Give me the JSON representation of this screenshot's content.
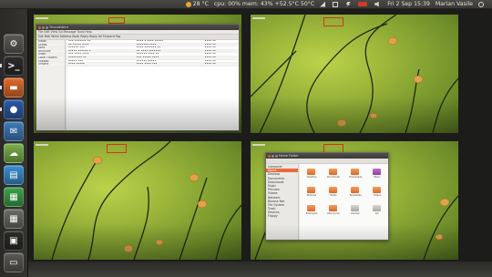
{
  "panel": {
    "weather": "28 °C",
    "sysmon": "cpu: 00% mem: 43% +52.5°C 50°C",
    "datetime": "Fri 2 Sep 15:39",
    "user": "Marian Vasile"
  },
  "launcher": {
    "items": [
      {
        "name": "dash-home",
        "glyph": "⚙",
        "color": "#5b5a55"
      },
      {
        "name": "terminal",
        "glyph": ">_",
        "color": "#2c2c2c"
      },
      {
        "name": "files",
        "glyph": "▬",
        "color": "#e06a2c"
      },
      {
        "name": "firefox",
        "glyph": "●",
        "color": "#2d5aa5"
      },
      {
        "name": "thunderbird",
        "glyph": "✉",
        "color": "#3f7bb8"
      },
      {
        "name": "pidgin",
        "glyph": "☁",
        "color": "#7bb04a"
      },
      {
        "name": "writer",
        "glyph": "▤",
        "color": "#3b8fd0"
      },
      {
        "name": "calc",
        "glyph": "▦",
        "color": "#3ea14a"
      },
      {
        "name": "calculator",
        "glyph": "▦",
        "color": "#6b6b66"
      },
      {
        "name": "ubuntu-one",
        "glyph": "▣",
        "color": "#2b2b28"
      },
      {
        "name": "workspace-switcher",
        "glyph": "▭",
        "color": "#5a5954"
      }
    ]
  },
  "workspaces": {
    "ws1": {
      "window_title": "Thunderbird",
      "menubar": "File  Edit  View  Go  Message  Tools  Help",
      "toolbar": "Get Mail  Write  Address Book  Reply  Reply All  Forward  Tag",
      "folders": [
        "Inbox",
        "Drafts",
        "Sent",
        "Archives",
        "Trash",
        "Local Folders",
        "Outbox",
        "Unsent"
      ],
      "messages": [
        [
          "••• ••••••• ••",
          "•••• • •••• •••••",
          "•••• ••"
        ],
        [
          "•• ••••• ••••",
          "••••••• ••••",
          "•••• ••"
        ],
        [
          "•••••• •••",
          "•••• ••••••• ••",
          "•••• ••"
        ],
        [
          "••••• •••••• •",
          "•• •••• •••••••",
          "•••• ••"
        ],
        [
          "••• •••• ••••",
          "•••••• •••• ••",
          "•••• ••"
        ],
        [
          "•••••••• ••",
          "••• ••••• ••••",
          "•••• ••"
        ],
        [
          "••••• •••",
          "•••••• •••••",
          "•••• ••"
        ],
        [
          "•••• •••••",
          "•••• •••• •••",
          "•••• ••"
        ]
      ]
    },
    "ws4": {
      "window_title": "Home Folder",
      "sidebar": [
        "Computer",
        "Home",
        "Desktop",
        "Documents",
        "Downloads",
        "Music",
        "Pictures",
        "Videos",
        "Network",
        "Browse Net",
        "File System",
        "Trash",
        "Devices",
        "Floppy"
      ],
      "folders": [
        "Desktop",
        "Documents",
        "Downloads",
        "Music",
        "Pictures",
        "Public",
        "Templates",
        "Videos",
        "Examples",
        "Ubuntu One",
        "backup",
        "bin"
      ]
    }
  },
  "colors": {
    "accent": "#e96a3a",
    "panel": "#3c3b37",
    "wallpaper": "#9ab53a",
    "battery": "#d23a2c"
  }
}
